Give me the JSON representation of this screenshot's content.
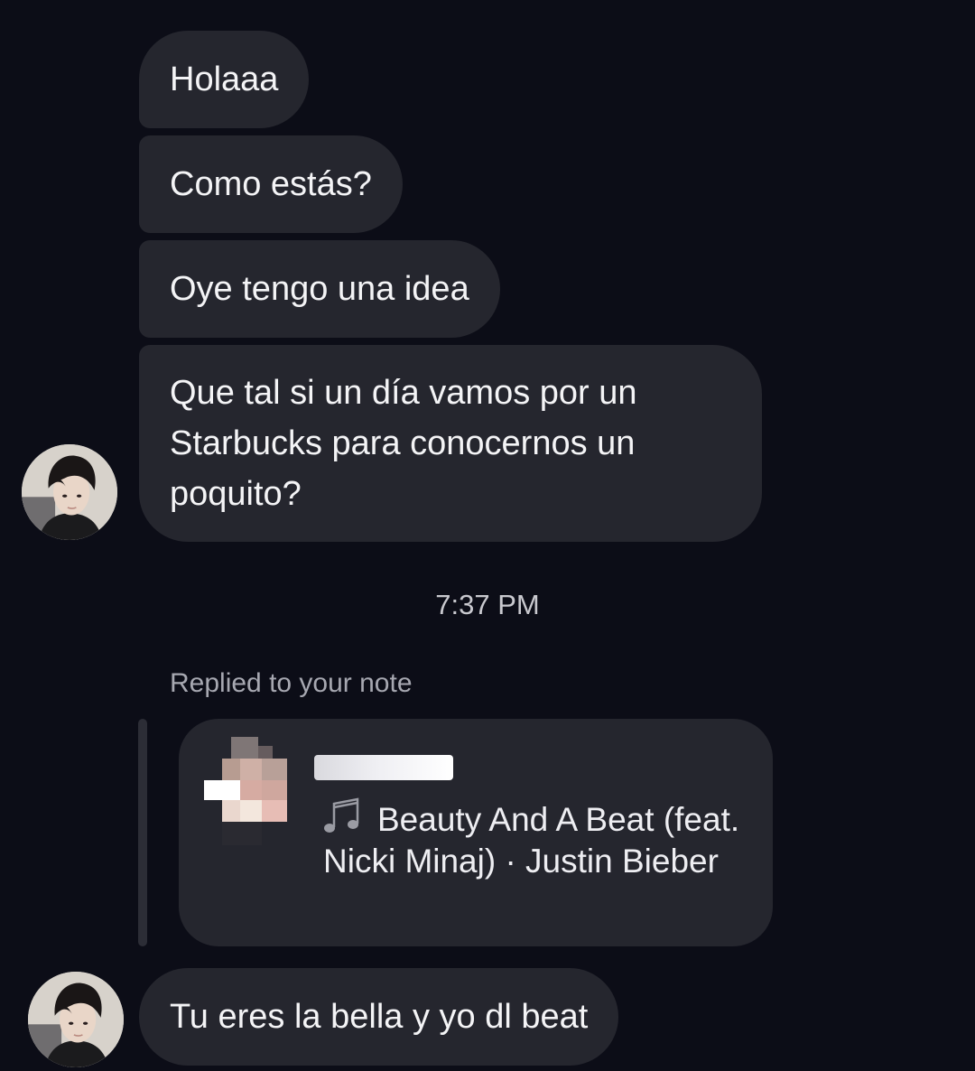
{
  "conversation": {
    "messages": [
      {
        "text": "Holaaa"
      },
      {
        "text": "Como estás?"
      },
      {
        "text": "Oye tengo una idea"
      },
      {
        "text": "Que tal si un día vamos por  un Starbucks para conocernos un poquito?"
      }
    ],
    "timestamp": "7:37 PM",
    "reply": {
      "label": "Replied to your note",
      "note_song": "Beauty And A Beat (feat. Nicki Minaj) · Justin Bieber",
      "note_icon": "music-note-icon"
    },
    "last_message": {
      "text": "Tu eres la bella y yo dl beat"
    }
  },
  "theme": {
    "background": "#0c0d17",
    "bubble": "#25262e",
    "text": "#f4f4f6",
    "secondary_text": "#a7a8b1"
  }
}
